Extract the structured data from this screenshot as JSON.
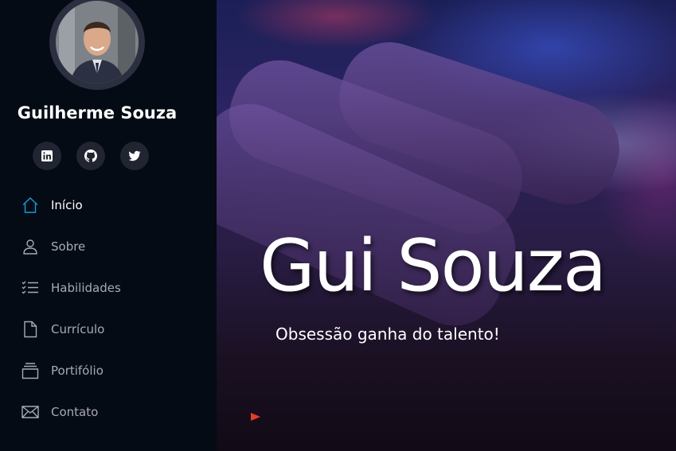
{
  "profile": {
    "name": "Guilherme Souza"
  },
  "socials": [
    {
      "icon": "linkedin-icon"
    },
    {
      "icon": "github-icon"
    },
    {
      "icon": "twitter-icon"
    }
  ],
  "nav": [
    {
      "label": "Início",
      "icon": "home-icon",
      "active": true
    },
    {
      "label": "Sobre",
      "icon": "person-icon"
    },
    {
      "label": "Habilidades",
      "icon": "checklist-icon"
    },
    {
      "label": "Currículo",
      "icon": "file-icon"
    },
    {
      "label": "Portifólio",
      "icon": "collection-icon"
    },
    {
      "label": "Contato",
      "icon": "envelope-icon"
    }
  ],
  "hero": {
    "title": "Gui Souza",
    "subtitle": "Obsessão ganha do talento!"
  },
  "colors": {
    "accent": "#149ddd",
    "sidebar_bg": "#040b14",
    "nav_text": "#a8a9b4"
  }
}
